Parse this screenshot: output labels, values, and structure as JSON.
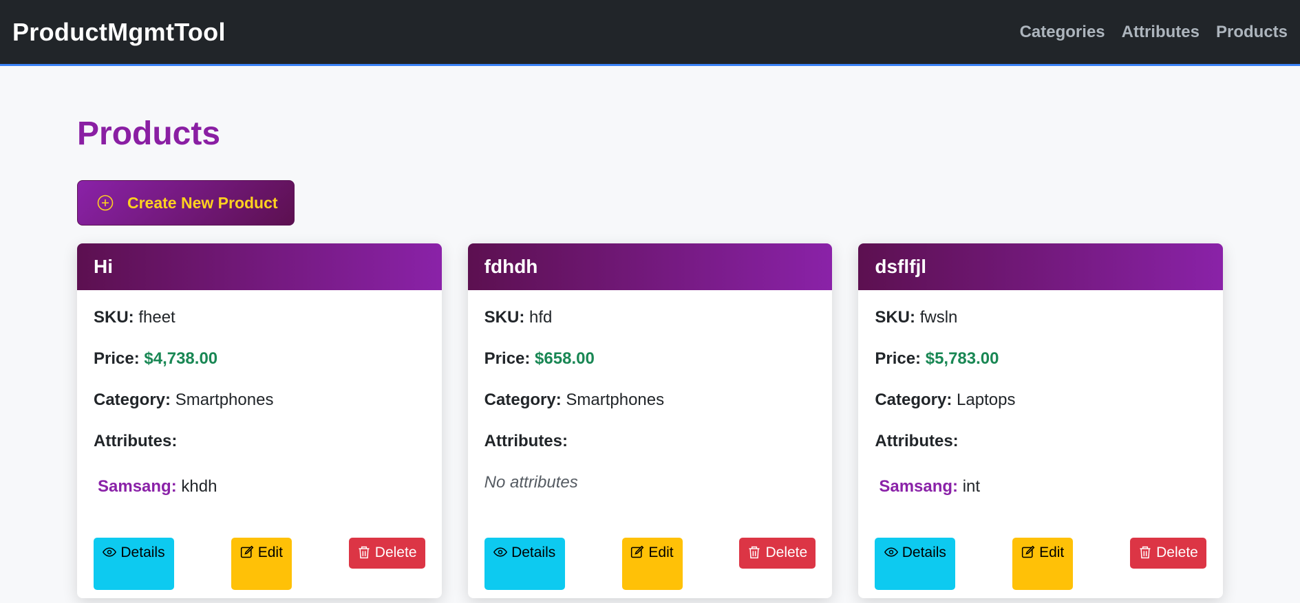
{
  "navbar": {
    "brand": "ProductMgmtTool",
    "links": [
      {
        "label": "Categories"
      },
      {
        "label": "Attributes"
      },
      {
        "label": "Products"
      }
    ]
  },
  "page": {
    "title": "Products",
    "create_button_label": "Create New Product",
    "create_button_icon": "plus-circle-icon"
  },
  "labels": {
    "sku": "SKU:",
    "price": "Price:",
    "category": "Category:",
    "attributes": "Attributes:",
    "no_attributes": "No attributes",
    "details": "Details",
    "edit": "Edit",
    "delete": "Delete"
  },
  "products": [
    {
      "name": "Hi",
      "sku": "fheet",
      "price": "$4,738.00",
      "category": "Smartphones",
      "attributes": [
        {
          "key": "Samsang:",
          "value": "khdh"
        }
      ]
    },
    {
      "name": "fdhdh",
      "sku": "hfd",
      "price": "$658.00",
      "category": "Smartphones",
      "attributes": []
    },
    {
      "name": "dsflfjl",
      "sku": "fwsln",
      "price": "$5,783.00",
      "category": "Laptops",
      "attributes": [
        {
          "key": "Samsang:",
          "value": "int"
        }
      ]
    }
  ],
  "colors": {
    "navbar_bg": "#212529",
    "accent_purple": "#8a1fa3",
    "button_text_yellow": "#ffd21f",
    "price_green": "#198754",
    "details_cyan": "#0dcaf0",
    "edit_yellow": "#ffc107",
    "delete_red": "#dc3545"
  }
}
